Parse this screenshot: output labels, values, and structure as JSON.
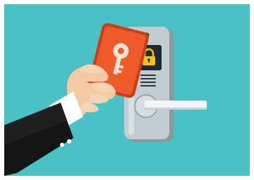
{
  "illustration": {
    "subject": "hand-holding-keycard-at-electronic-door-lock",
    "icons": [
      "keycard-icon",
      "key-icon",
      "padlock-icon",
      "door-handle-icon"
    ]
  },
  "colors": {
    "background": "#49c1c5",
    "frame": "#ffffff",
    "lock_body": "#b9c3c8",
    "lock_shadow": "#8e999f",
    "screen": "#1f2a30",
    "padlock": "#f2c21b",
    "card": "#ef5a2a",
    "card_dark": "#c73e17",
    "skin": "#f4c9a3",
    "sleeve": "#1f1f1f",
    "cuff": "#ffffff"
  }
}
